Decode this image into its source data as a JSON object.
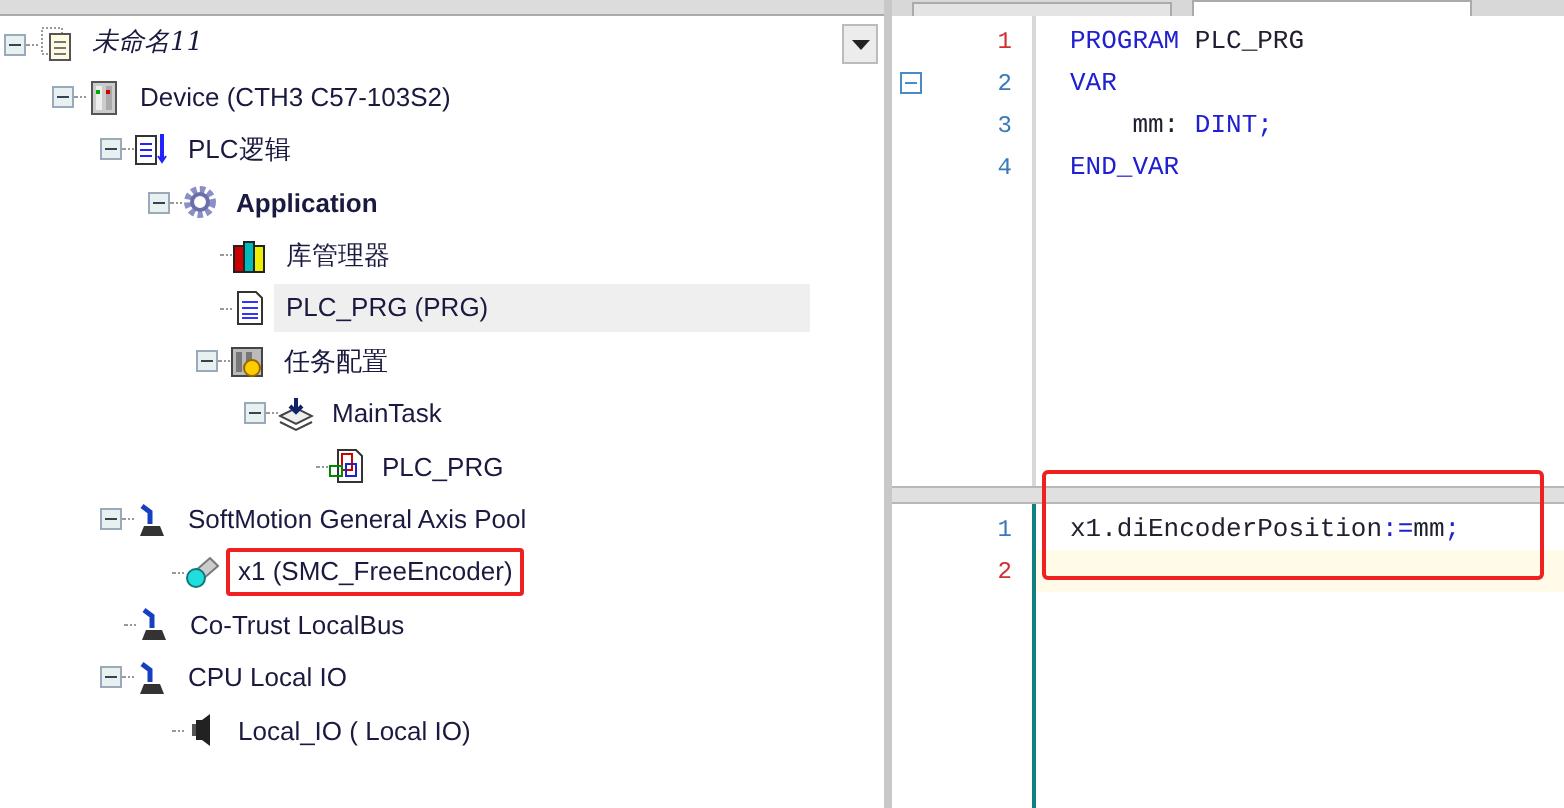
{
  "tree": [
    {
      "label": "未命名11",
      "kind": "project",
      "italic": true,
      "bold": false,
      "selected": false,
      "highlighted": false,
      "expanded": true,
      "children": [
        {
          "label": "Device (CTH3 C57-103S2)",
          "kind": "device",
          "italic": false,
          "bold": false,
          "selected": false,
          "highlighted": false,
          "expanded": true,
          "children": [
            {
              "label": "PLC逻辑",
              "kind": "plc-logic",
              "italic": false,
              "bold": false,
              "selected": false,
              "highlighted": false,
              "expanded": true,
              "children": [
                {
                  "label": "Application",
                  "kind": "gear",
                  "italic": false,
                  "bold": true,
                  "selected": false,
                  "highlighted": false,
                  "expanded": true,
                  "children": [
                    {
                      "label": "库管理器",
                      "kind": "library",
                      "italic": false,
                      "bold": false,
                      "selected": false,
                      "highlighted": false
                    },
                    {
                      "label": "PLC_PRG (PRG)",
                      "kind": "pou",
                      "italic": false,
                      "bold": false,
                      "selected": true,
                      "highlighted": false
                    },
                    {
                      "label": "任务配置",
                      "kind": "task-config",
                      "italic": false,
                      "bold": false,
                      "selected": false,
                      "highlighted": false,
                      "expanded": true,
                      "children": [
                        {
                          "label": "MainTask",
                          "kind": "task",
                          "italic": false,
                          "bold": false,
                          "selected": false,
                          "highlighted": false,
                          "expanded": true,
                          "children": [
                            {
                              "label": "PLC_PRG",
                              "kind": "pou-call",
                              "italic": false,
                              "bold": false,
                              "selected": false,
                              "highlighted": false
                            }
                          ]
                        }
                      ]
                    }
                  ]
                }
              ]
            },
            {
              "label": "SoftMotion General Axis Pool",
              "kind": "axis",
              "italic": false,
              "bold": false,
              "selected": false,
              "highlighted": false,
              "expanded": true,
              "children": [
                {
                  "label": "x1 (SMC_FreeEncoder)",
                  "kind": "encoder",
                  "italic": false,
                  "bold": false,
                  "selected": false,
                  "highlighted": true
                }
              ]
            },
            {
              "label": "Co-Trust LocalBus",
              "kind": "axis",
              "italic": false,
              "bold": false,
              "selected": false,
              "highlighted": false
            },
            {
              "label": "CPU Local IO",
              "kind": "axis",
              "italic": false,
              "bold": false,
              "selected": false,
              "highlighted": false,
              "expanded": true,
              "children": [
                {
                  "label": "Local_IO ( Local IO)",
                  "kind": "io",
                  "italic": false,
                  "bold": false,
                  "selected": false,
                  "highlighted": false
                }
              ]
            }
          ]
        }
      ]
    }
  ],
  "declaration_editor": {
    "lines": [
      {
        "number": "1",
        "current": true,
        "tokens": [
          {
            "text": "PROGRAM ",
            "kind": "keyword"
          },
          {
            "text": "PLC_PRG",
            "kind": "plain"
          }
        ]
      },
      {
        "number": "2",
        "current": false,
        "foldable": true,
        "tokens": [
          {
            "text": "VAR",
            "kind": "keyword"
          }
        ]
      },
      {
        "number": "3",
        "current": false,
        "tokens": [
          {
            "text": "    mm: ",
            "kind": "plain"
          },
          {
            "text": "DINT;",
            "kind": "keyword"
          }
        ]
      },
      {
        "number": "4",
        "current": false,
        "tokens": [
          {
            "text": "END_VAR",
            "kind": "keyword"
          }
        ]
      }
    ]
  },
  "code_editor": {
    "highlighted": true,
    "lines": [
      {
        "number": "1",
        "current": false,
        "tokens": [
          {
            "text": "x1.diEncoderPosition",
            "kind": "plain"
          },
          {
            "text": ":=",
            "kind": "keyword"
          },
          {
            "text": "mm",
            "kind": "plain"
          },
          {
            "text": ";",
            "kind": "keyword"
          }
        ]
      },
      {
        "number": "2",
        "current": true
      }
    ]
  }
}
